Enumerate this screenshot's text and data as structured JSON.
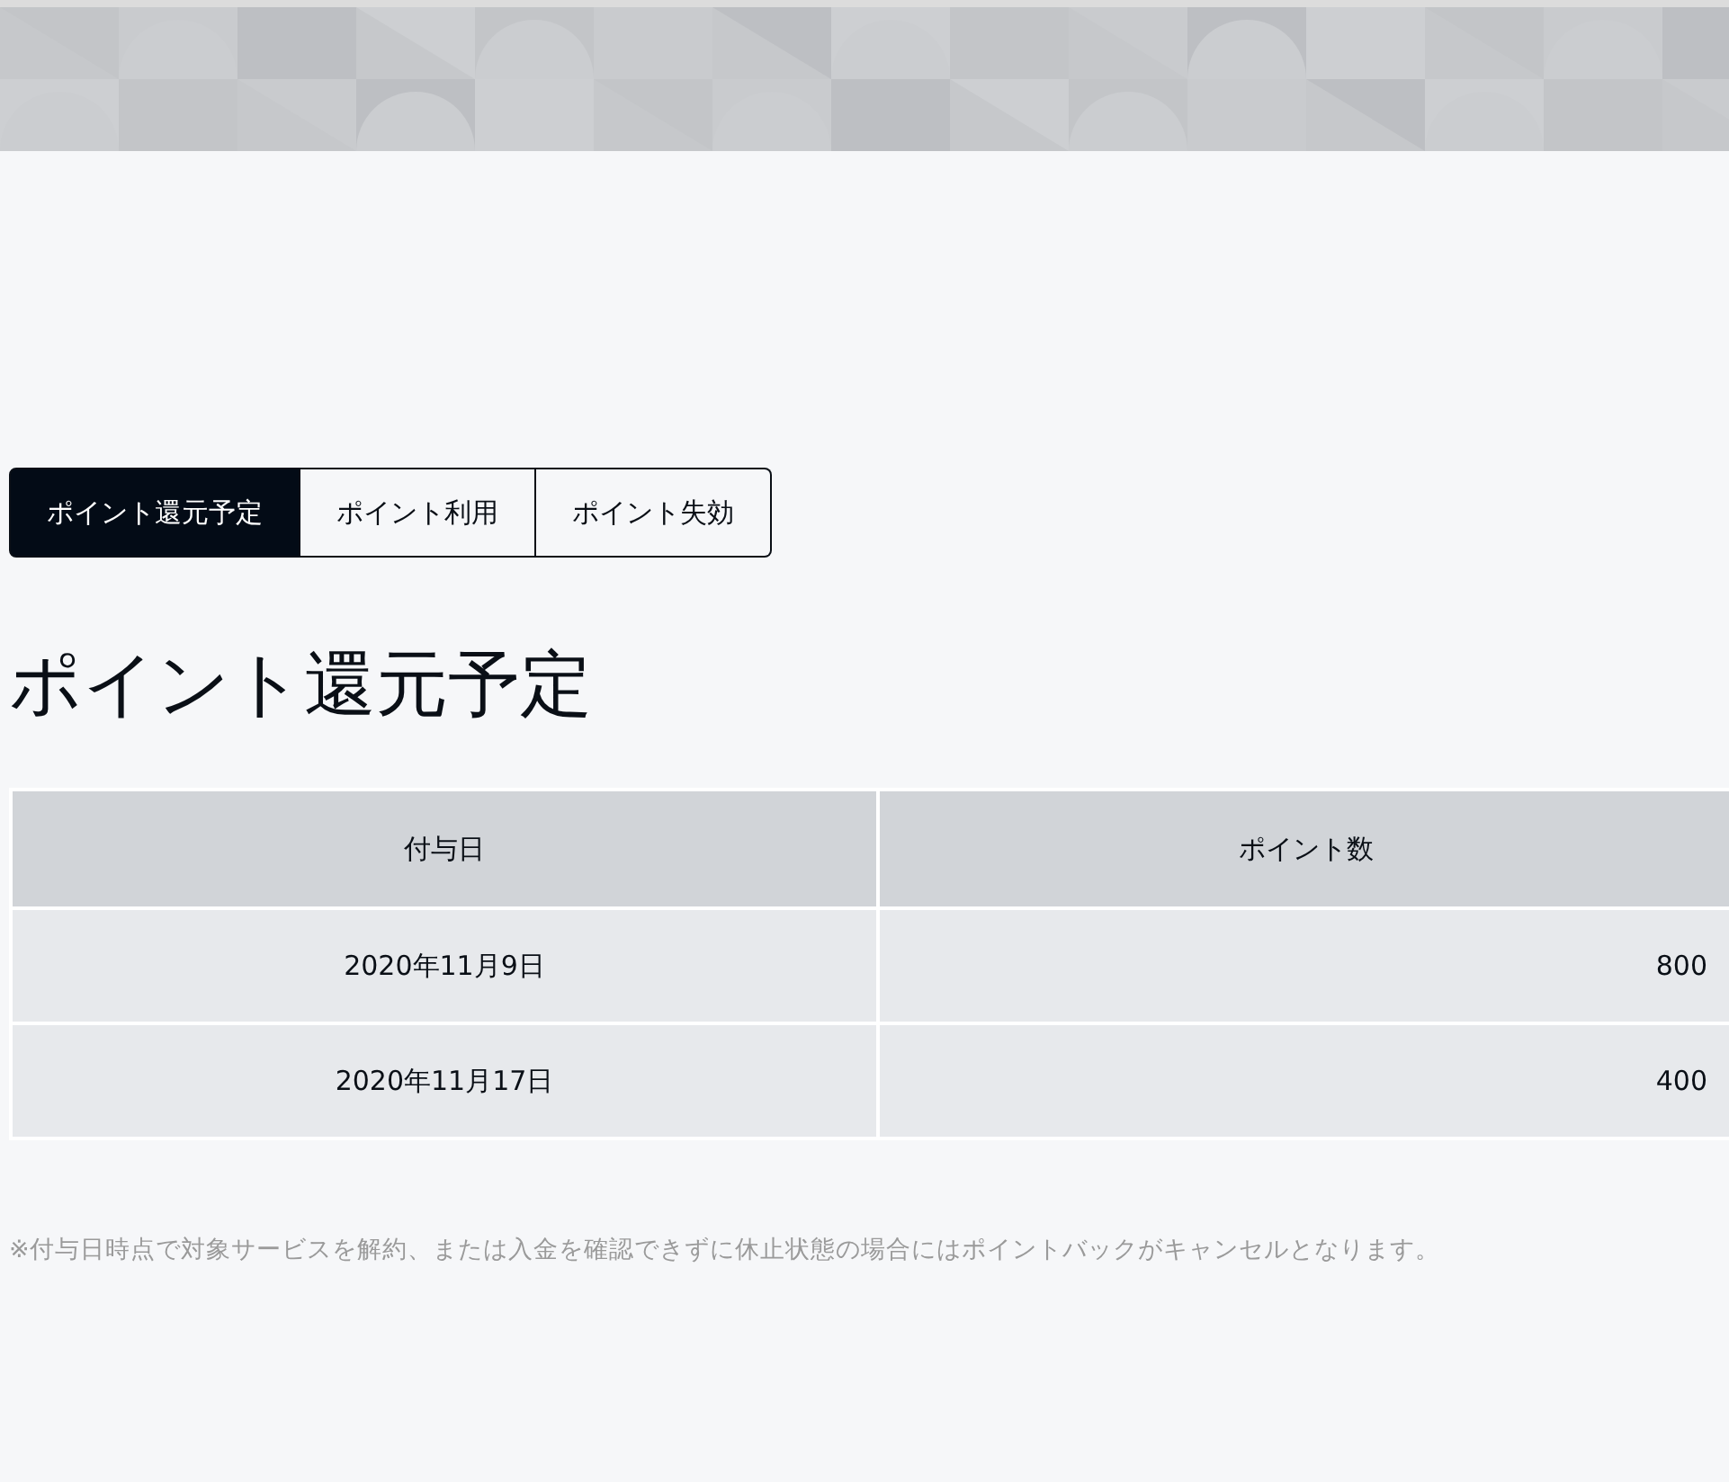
{
  "tabs": [
    {
      "label": "ポイント還元予定",
      "selected": true
    },
    {
      "label": "ポイント利用",
      "selected": false
    },
    {
      "label": "ポイント失効",
      "selected": false
    }
  ],
  "heading": "ポイント還元予定",
  "table": {
    "columns": [
      "付与日",
      "ポイント数"
    ],
    "rows": [
      [
        "2020年11月9日",
        "800"
      ],
      [
        "2020年11月17日",
        "400"
      ]
    ]
  },
  "note": "※付与日時点で対象サービスを解約、または入金を確認できずに休止状態の場合にはポイントバックがキャンセルとなります。"
}
